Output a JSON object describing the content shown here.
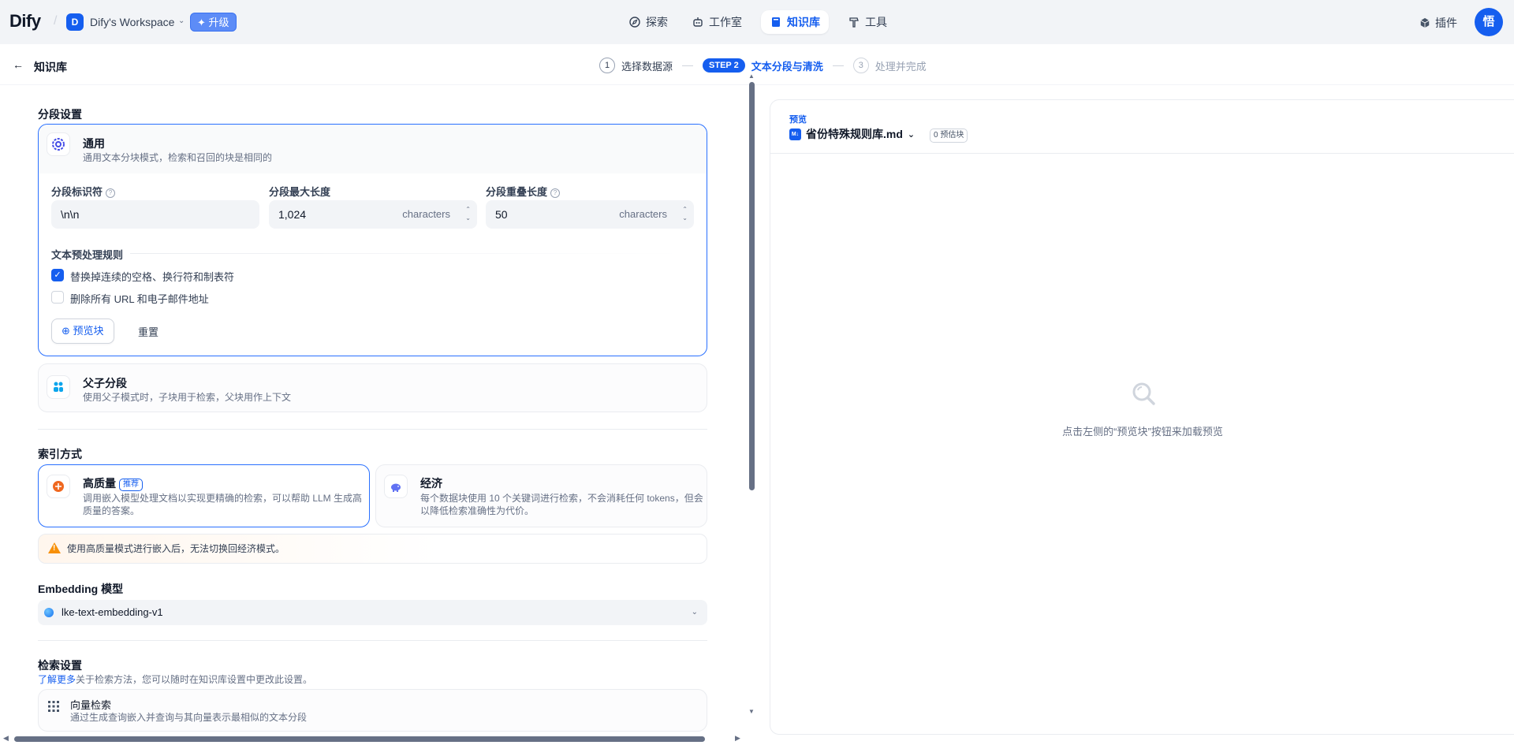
{
  "brand": {
    "logo_text": "Dify"
  },
  "workspace": {
    "initial": "D",
    "name": "Dify's Workspace",
    "upgrade_label": "升级"
  },
  "nav": {
    "explore": "探索",
    "studio": "工作室",
    "knowledge": "知识库",
    "tools": "工具",
    "plugins": "插件",
    "user_initial": "悟"
  },
  "header": {
    "back_label": "知识库"
  },
  "steps": {
    "step1_num": "1",
    "step1_label": "选择数据源",
    "step2_pill": "STEP 2",
    "step2_label": "文本分段与清洗",
    "step3_num": "3",
    "step3_label": "处理并完成"
  },
  "segment": {
    "section_title": "分段设置",
    "general": {
      "title": "通用",
      "desc": "通用文本分块模式，检索和召回的块是相同的",
      "delimiter_label": "分段标识符",
      "delimiter_value": "\\n\\n",
      "maxlen_label": "分段最大长度",
      "maxlen_value": "1,024",
      "maxlen_unit": "characters",
      "overlap_label": "分段重叠长度",
      "overlap_value": "50",
      "overlap_unit": "characters",
      "rules_title": "文本预处理规则",
      "rule1": "替换掉连续的空格、换行符和制表符",
      "rule1_checked": true,
      "rule2": "删除所有 URL 和电子邮件地址",
      "rule2_checked": false,
      "preview_btn": "预览块",
      "reset_btn": "重置"
    },
    "parent_child": {
      "title": "父子分段",
      "desc": "使用父子模式时，子块用于检索，父块用作上下文"
    }
  },
  "index": {
    "section_title": "索引方式",
    "high_quality": {
      "title": "高质量",
      "badge": "推荐",
      "desc": "调用嵌入模型处理文档以实现更精确的检索，可以帮助 LLM 生成高质量的答案。"
    },
    "economy": {
      "title": "经济",
      "desc": "每个数据块使用 10 个关键词进行检索，不会消耗任何 tokens，但会以降低检索准确性为代价。"
    },
    "warning": "使用高质量模式进行嵌入后，无法切换回经济模式。"
  },
  "embedding": {
    "section_title": "Embedding 模型",
    "model": "lke-text-embedding-v1"
  },
  "retrieval": {
    "section_title": "检索设置",
    "learn_more": "了解更多",
    "hint": "关于检索方法，您可以随时在知识库设置中更改此设置。",
    "vector": {
      "title": "向量检索",
      "desc": "通过生成查询嵌入并查询与其向量表示最相似的文本分段"
    }
  },
  "preview": {
    "label": "预览",
    "file_name": "省份特殊规则库.md",
    "file_badge": "M↓",
    "chunks": "0 预估块",
    "empty_text": "点击左侧的“预览块”按钮来加载预览"
  },
  "colors": {
    "accent": "#155eef",
    "warning": "#f79009",
    "border": "#eaecf0"
  }
}
